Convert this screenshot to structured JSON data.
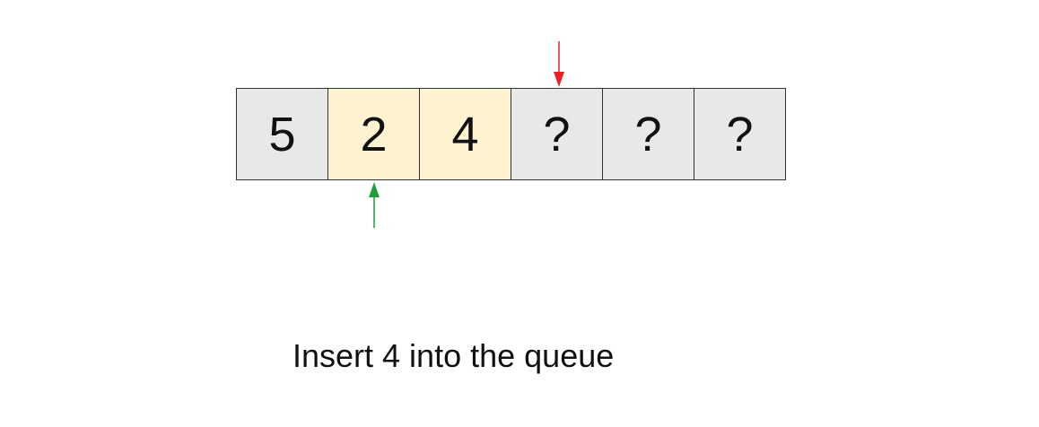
{
  "cells": [
    {
      "value": "5",
      "state": "empty",
      "fill": "#e8e8e8"
    },
    {
      "value": "2",
      "state": "occupied",
      "fill": "#fdf3d1"
    },
    {
      "value": "4",
      "state": "occupied",
      "fill": "#fdf3d1"
    },
    {
      "value": "?",
      "state": "empty",
      "fill": "#e8e8e8"
    },
    {
      "value": "?",
      "state": "empty",
      "fill": "#e8e8e8"
    },
    {
      "value": "?",
      "state": "empty",
      "fill": "#e8e8e8"
    }
  ],
  "pointers": {
    "tail": {
      "color": "#e8202a",
      "direction": "down",
      "cell_index": 3
    },
    "head": {
      "color": "#1e9e3e",
      "direction": "up",
      "cell_index": 1
    }
  },
  "caption": "Insert 4 into the queue",
  "colors": {
    "border": "#333333",
    "text": "#111111"
  }
}
